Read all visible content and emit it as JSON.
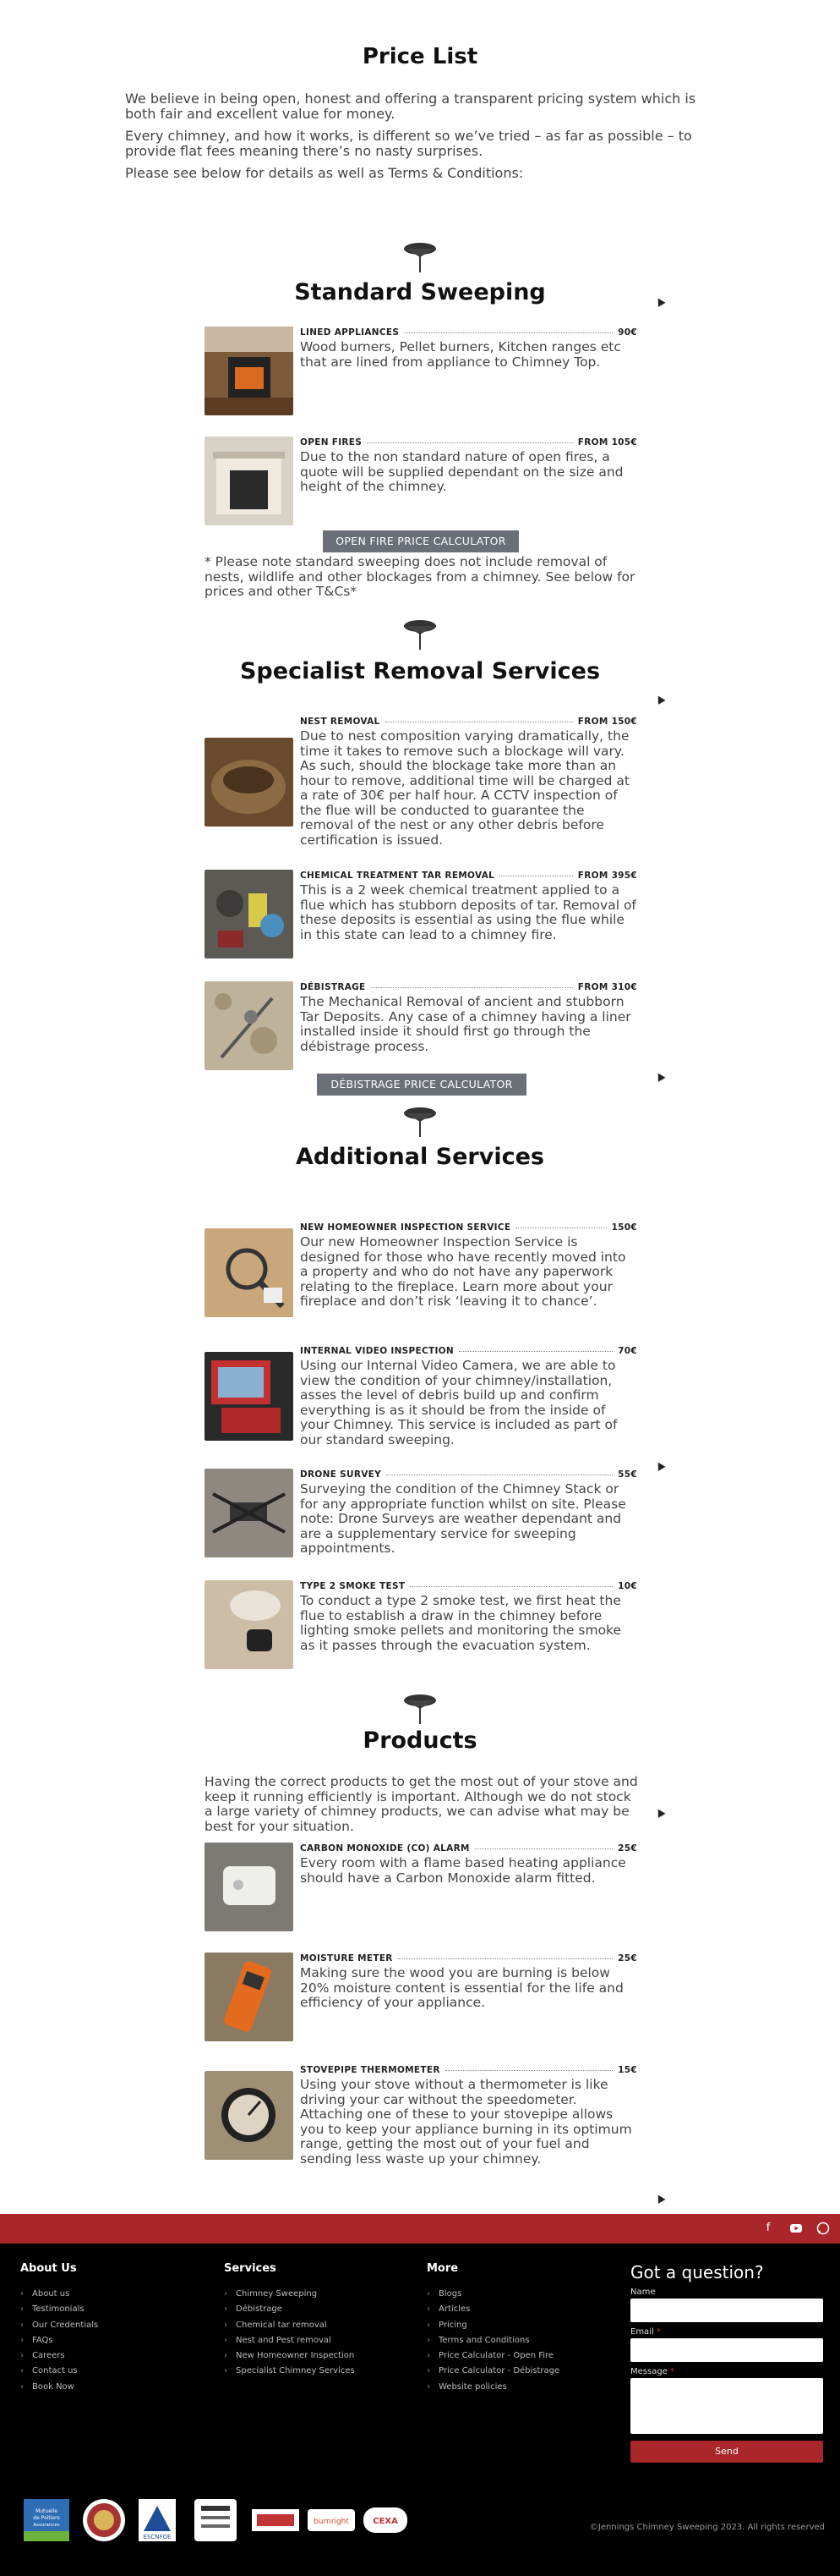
{
  "page_title": "Price List",
  "intro": [
    "We believe in being open, honest and offering a transparent pricing system which is both fair and excellent value for money.",
    "Every chimney, and how it works, is different so we’ve tried – as far as possible – to provide flat fees meaning there’s no nasty surprises.",
    "Please see below for details as well as Terms & Conditions:"
  ],
  "sections": {
    "standard": {
      "title": "Standard Sweeping"
    },
    "specialist": {
      "title": "Specialist Removal Services"
    },
    "additional": {
      "title": "Additional Services"
    },
    "products": {
      "title": "Products",
      "intro": "Having the correct products to get the most out of your stove and keep it running efficiently is important. Although we do not stock a large variety of chimney products, we can advise what may be best for your situation."
    }
  },
  "items": {
    "lined": {
      "name": "LINED APPLIANCES",
      "price": "90€",
      "desc": "Wood burners, Pellet burners, Kitchen ranges etc that are lined from appliance to Chimney Top."
    },
    "open_fires": {
      "name": "OPEN FIRES",
      "price": "FROM 105€",
      "desc": "Due to the non standard nature of open fires, a quote will be supplied dependant on the size and height of the chimney."
    },
    "nest": {
      "name": "NEST REMOVAL",
      "price": "FROM 150€",
      "desc": "Due to nest composition varying dramatically, the time it takes to remove such a blockage will vary. As such, should the blockage take more than an hour to remove, additional time will be charged at a rate of 30€ per half hour. A CCTV inspection of the flue will be conducted to guarantee the removal of the nest or any other debris before certification is issued."
    },
    "chemical": {
      "name": "CHEMICAL TREATMENT TAR REMOVAL",
      "price": "FROM 395€",
      "desc": "This is a 2 week chemical treatment applied to a flue which has stubborn deposits of tar. Removal of these deposits is essential as using the flue while in this state can lead to a chimney fire."
    },
    "debistrage": {
      "name": "DÉBISTRAGE",
      "price": "FROM 310€",
      "desc": "The Mechanical Removal of ancient and stubborn Tar Deposits. Any case of a chimney having a liner installed inside it should first go through the débistrage process."
    },
    "homeowner": {
      "name": "NEW HOMEOWNER INSPECTION SERVICE",
      "price": "150€",
      "desc": "Our new Homeowner Inspection Service is designed for those who have recently moved into a property and who do not have any paperwork relating to the fireplace. Learn more about your fireplace and don’t risk ‘leaving it to chance’."
    },
    "video": {
      "name": "INTERNAL VIDEO INSPECTION",
      "price": "70€",
      "desc": "Using our Internal Video Camera, we are able to view the condition of your chimney/installation, asses the level of debris build up and confirm everything is as it should be from the inside of your Chimney. This service is included as part of our standard sweeping."
    },
    "drone": {
      "name": "DRONE SURVEY",
      "price": "55€",
      "desc": "Surveying the condition of the Chimney Stack or for any appropriate function whilst on site. Please note: Drone Surveys are weather dependant and are a supplementary service for sweeping appointments."
    },
    "smoke": {
      "name": "TYPE 2 SMOKE TEST",
      "price": "10€",
      "desc": "To conduct a type 2 smoke test, we first heat the flue to establish a draw in the chimney before lighting smoke pellets and monitoring the smoke as it passes through the evacuation system."
    },
    "co_alarm": {
      "name": "CARBON MONOXIDE (CO) ALARM",
      "price": "25€",
      "desc": "Every room with a flame based heating appliance should have a Carbon Monoxide alarm fitted."
    },
    "moisture": {
      "name": "MOISTURE METER",
      "price": "25€",
      "desc": "Making sure the wood you are burning is below 20% moisture content is essential for the life and efficiency of your appliance."
    },
    "thermometer": {
      "name": "STOVEPIPE THERMOMETER",
      "price": "15€",
      "desc": "Using your stove without a thermometer is like driving your car without the speedometer. Attaching one of these to your stovepipe allows you to keep your appliance burning in its optimum range, getting the most out of your fuel and sending less waste up your chimney."
    }
  },
  "buttons": {
    "open_fire_calc": "OPEN FIRE PRICE CALCULATOR",
    "debistrage_calc": "DÉBISTRAGE PRICE CALCULATOR"
  },
  "standard_note": "* Please note standard sweeping does not include removal of nests, wildlife and other blockages from a chimney. See below for prices and other T&Cs*",
  "social": [
    "facebook-icon",
    "youtube-icon",
    "whatsapp-icon"
  ],
  "footer": {
    "about": {
      "title": "About Us",
      "links": [
        "About us",
        "Testimonials",
        "Our Credentials",
        "FAQs",
        "Careers",
        "Contact us",
        "Book Now"
      ]
    },
    "services": {
      "title": "Services",
      "links": [
        "Chimney Sweeping",
        "Débistrage",
        "Chemical tar removal",
        "Nest and Pest removal",
        "New Homeowner Inspection",
        "Specialist Chimney Services"
      ]
    },
    "more": {
      "title": "More",
      "links": [
        "Blogs",
        "Articles",
        "Pricing",
        "Terms and Conditions",
        "Price Calculator - Open Fire",
        "Price Calculator - Débistrage",
        "Website policies"
      ]
    },
    "form": {
      "title": "Got a question?",
      "name_label": "Name",
      "email_label": "Email",
      "message_label": "Message",
      "required": "*",
      "send": "Send"
    },
    "logos": [
      "Mutuelle de Poitiers Assurances",
      "seal-logo",
      "ESCNFOE",
      "certificate-logo",
      "partner-logo",
      "burnright",
      "CEXA"
    ],
    "copyright": "©Jennings Chimney Sweeping 2023. All rights reserved"
  },
  "colors": {
    "accent": "#a9262a",
    "button": "#6b6f78",
    "footer_bg": "#000000"
  }
}
